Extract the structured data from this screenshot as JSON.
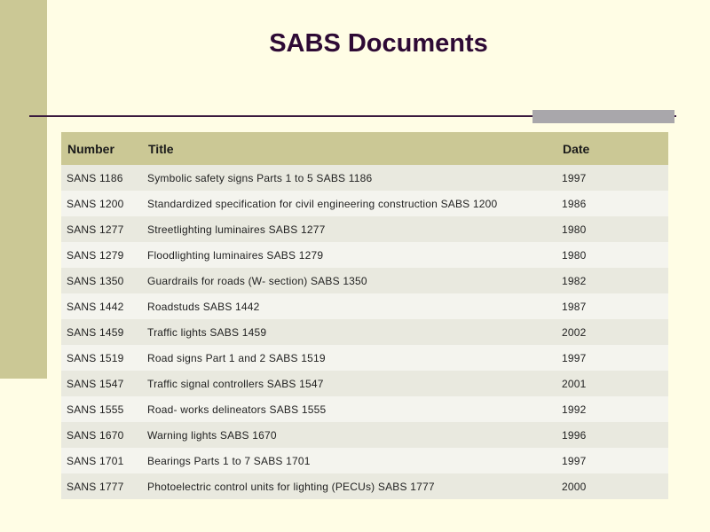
{
  "slide": {
    "title": "SABS Documents"
  },
  "table": {
    "headers": {
      "number": "Number",
      "title": "Title",
      "date": "Date"
    },
    "rows": [
      {
        "number": "SANS 1186",
        "title": "Symbolic safety signs Parts 1 to 5 SABS 1186",
        "date": "1997"
      },
      {
        "number": "SANS 1200",
        "title": "Standardized specification for civil engineering construction SABS 1200",
        "date": "1986"
      },
      {
        "number": "SANS 1277",
        "title": "Streetlighting luminaires SABS 1277",
        "date": "1980"
      },
      {
        "number": "SANS 1279",
        "title": "Floodlighting luminaires SABS 1279",
        "date": "1980"
      },
      {
        "number": "SANS 1350",
        "title": "Guardrails for roads (W- section) SABS 1350",
        "date": "1982"
      },
      {
        "number": "SANS 1442",
        "title": "Roadstuds SABS 1442",
        "date": "1987"
      },
      {
        "number": "SANS 1459",
        "title": "Traffic lights SABS 1459",
        "date": "2002"
      },
      {
        "number": "SANS 1519",
        "title": "Road signs Part 1 and 2 SABS 1519",
        "date": "1997"
      },
      {
        "number": "SANS 1547",
        "title": "Traffic signal controllers SABS 1547",
        "date": "2001"
      },
      {
        "number": "SANS 1555",
        "title": "Road- works delineators SABS 1555",
        "date": "1992"
      },
      {
        "number": "SANS 1670",
        "title": "Warning lights SABS 1670",
        "date": "1996"
      },
      {
        "number": "SANS 1701",
        "title": "Bearings Parts 1 to 7 SABS 1701",
        "date": "1997"
      },
      {
        "number": "SANS 1777",
        "title": "Photoelectric control units for lighting (PECUs) SABS 1777",
        "date": "2000"
      }
    ]
  },
  "colors": {
    "background": "#fffde5",
    "accent_bar": "#cbc895",
    "title": "#2e0a35",
    "rule": "#3a1a3e",
    "rule_accent": "#a9a7ab"
  }
}
